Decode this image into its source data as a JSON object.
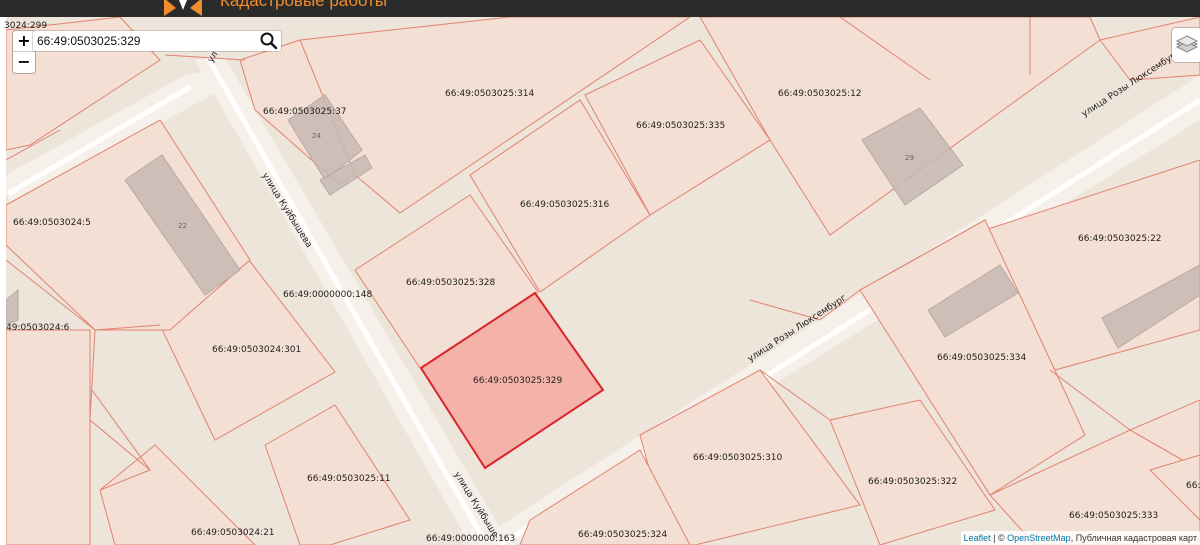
{
  "header": {
    "brand_text": "Кадастровые работы"
  },
  "search": {
    "value": "66:49:0503025:329",
    "placeholder": ""
  },
  "zoom": {
    "in_label": "+",
    "out_label": "−"
  },
  "map": {
    "corner_label": "3024:299",
    "selected_parcel": "66:49:0503025:329",
    "parcels": [
      "66:49:0503025:37",
      "66:49:0503025:314",
      "66:49:0503025:12",
      "66:49:0503025:335",
      "66:49:0503024:5",
      "66:49:0503025:316",
      "66:49:0503025:22",
      "66:49:0503025:328",
      "66:49:0000000:148",
      "49:0503024:6",
      "66:49:0503024:301",
      "66:49:0503025:329",
      "66:49:0503025:334",
      "66:49:0503025:310",
      "66:49:0503025:322",
      "66:49:0503025:11",
      "66:49:0503025:333",
      "66:49:0503024:21",
      "66:49:0000000:163",
      "66:49:0503025:324",
      "66:4"
    ],
    "house_numbers": [
      "24",
      "29",
      "22"
    ],
    "streets": {
      "kuibysheva": "улица Куйбышева",
      "kuibysheva_short": "улица Куйбыше",
      "kuibysheva_top": "ул и",
      "rozy_1": "улица Розы Люксембург",
      "rozy_2": "улица Розы Люксембург"
    },
    "colors": {
      "background": "#ede4da",
      "parcel_fill": "#f3dfd3",
      "parcel_stroke": "#e2826f",
      "selected_fill": "#f4b2a8",
      "selected_stroke": "#d9262b",
      "road": "#ffffff",
      "building": "#c7b8b3"
    }
  },
  "attribution": {
    "leaflet": "Leaflet",
    "separator": " | © ",
    "osm": "OpenStreetMap",
    "rest": ", Публичная кадастровая карт"
  }
}
